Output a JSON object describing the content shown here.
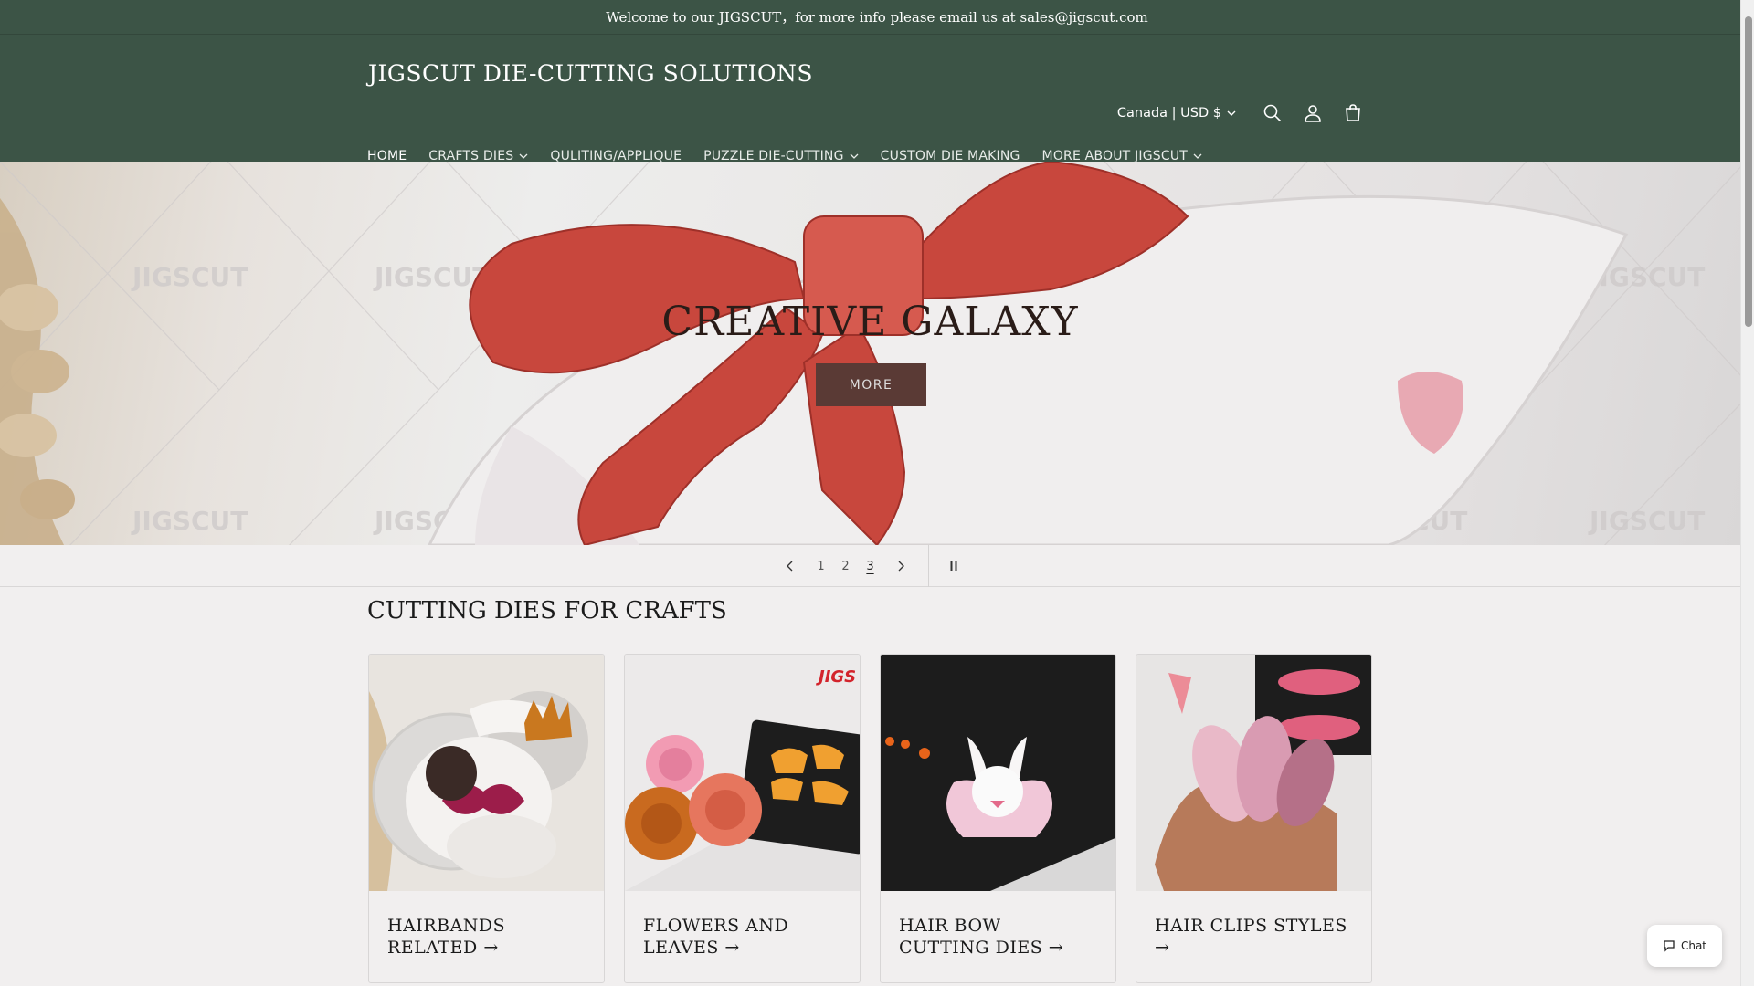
{
  "announcement": "Welcome to our JIGSCUT，for more info please email us at sales@jigscut.com",
  "header": {
    "logo": "JIGSCUT DIE-CUTTING SOLUTIONS",
    "country_selector": "Canada | USD $",
    "icons": [
      "search-icon",
      "account-icon",
      "cart-icon"
    ]
  },
  "nav": {
    "items": [
      {
        "label": "HOME"
      },
      {
        "label": "CRAFTS DIES"
      },
      {
        "label": "QULITING/APPLIQUE"
      },
      {
        "label": "PUZZLE DIE-CUTTING"
      },
      {
        "label": "CUSTOM DIE MAKING"
      },
      {
        "label": "MORE ABOUT JIGSCUT"
      }
    ]
  },
  "hero": {
    "title": "CREATIVE GALAXY",
    "button": "MORE",
    "watermark": "JIGSCUT"
  },
  "slider": {
    "slides": [
      "1",
      "2",
      "3"
    ],
    "active_slide": 3
  },
  "section": {
    "title": "CUTTING DIES FOR CRAFTS"
  },
  "cards": [
    {
      "title": "HAIRBANDS RELATED"
    },
    {
      "title": "FLOWERS AND LEAVES"
    },
    {
      "title": "HAIR BOW CUTTING DIES"
    },
    {
      "title": "HAIR CLIPS STYLES"
    }
  ],
  "chat": {
    "label": "Chat"
  },
  "colors": {
    "header_bg": "#3c5446",
    "page_bg": "#f1efef",
    "hero_button": "#5a3a35"
  }
}
